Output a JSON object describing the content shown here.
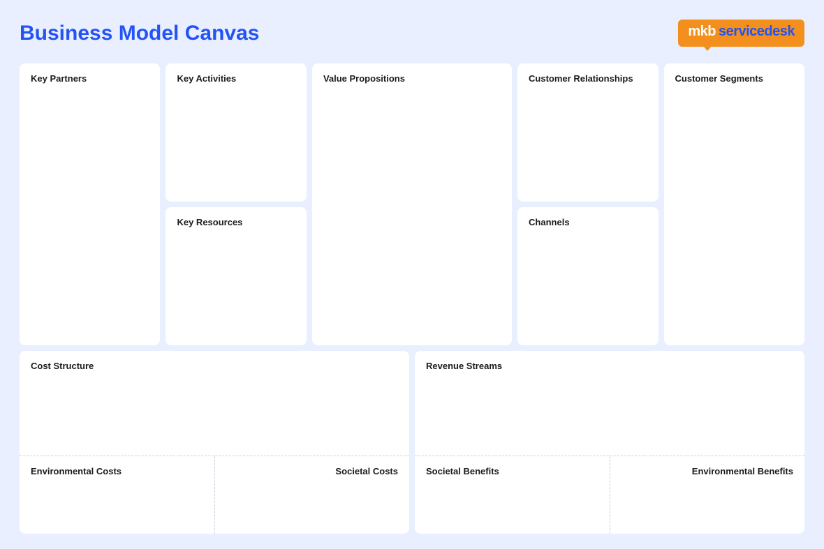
{
  "header": {
    "title": "Business Model Canvas",
    "logo": {
      "part1": "mkb",
      "part2": "servicedesk"
    }
  },
  "blocks": {
    "key_partners": "Key Partners",
    "key_activities": "Key Activities",
    "key_resources": "Key Resources",
    "value_propositions": "Value Propositions",
    "customer_relationships": "Customer Relationships",
    "channels": "Channels",
    "customer_segments": "Customer Segments",
    "cost_structure": "Cost Structure",
    "environmental_costs": "Environmental Costs",
    "societal_costs": "Societal Costs",
    "revenue_streams": "Revenue Streams",
    "societal_benefits": "Societal Benefits",
    "environmental_benefits": "Environmental Benefits"
  }
}
